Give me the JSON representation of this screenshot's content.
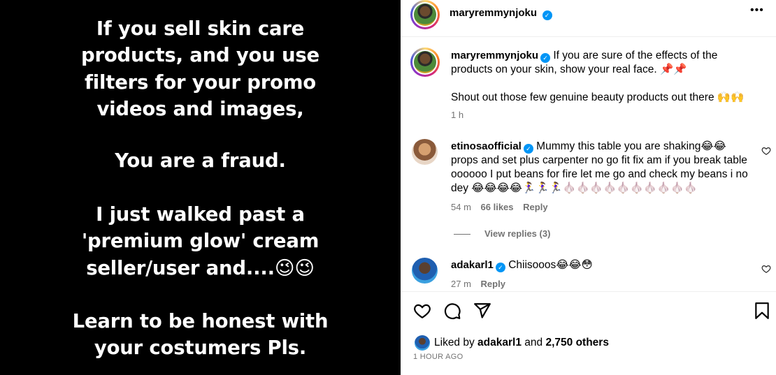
{
  "media": {
    "paragraphs": [
      [
        "If you sell skin care",
        "products,  and you use",
        "filters for your promo",
        "videos and images,"
      ],
      [
        "You are a fraud."
      ],
      [
        "I just walked past a",
        "'premium glow' cream",
        "seller/user and....😉😉"
      ],
      [
        "Learn to be honest with",
        "your costumers Pls."
      ]
    ]
  },
  "header": {
    "username": "maryremmynjoku",
    "verified_icon": "verified-badge-icon",
    "more_icon": "more-options-icon",
    "more_label": "•••"
  },
  "caption": {
    "username": "maryremmynjoku",
    "text1": "If you are sure of the effects of the products on your skin, show your real face. 📌📌",
    "text2": "Shout out those few genuine beauty products out there 🙌🙌",
    "time": "1 h"
  },
  "comments": [
    {
      "username": "etinosaofficial",
      "text": "Mummy this table you are shaking😂😂 props and set plus carpenter no go fit fix am if you break table oooooo I put beans for fire let me go and check my beans i no dey 😂😂😂😂🏃‍♀️🏃‍♀️🏃‍♀️🧄🧄🧄🧄🧄🧄🧄🧄🧄🧄",
      "time": "54 m",
      "likes": "66 likes",
      "reply": "Reply",
      "view_replies": "View replies (3)"
    },
    {
      "username": "adakarl1",
      "text": "Chiisooos😂😂😳",
      "time": "27 m",
      "reply": "Reply"
    }
  ],
  "actions": {
    "like_icon": "heart-icon",
    "comment_icon": "comment-icon",
    "share_icon": "share-icon",
    "save_icon": "bookmark-icon"
  },
  "likes": {
    "prefix": "Liked by",
    "user": "adakarl1",
    "middle": "and",
    "others": "2,750 others"
  },
  "timestamp": "1 HOUR AGO"
}
